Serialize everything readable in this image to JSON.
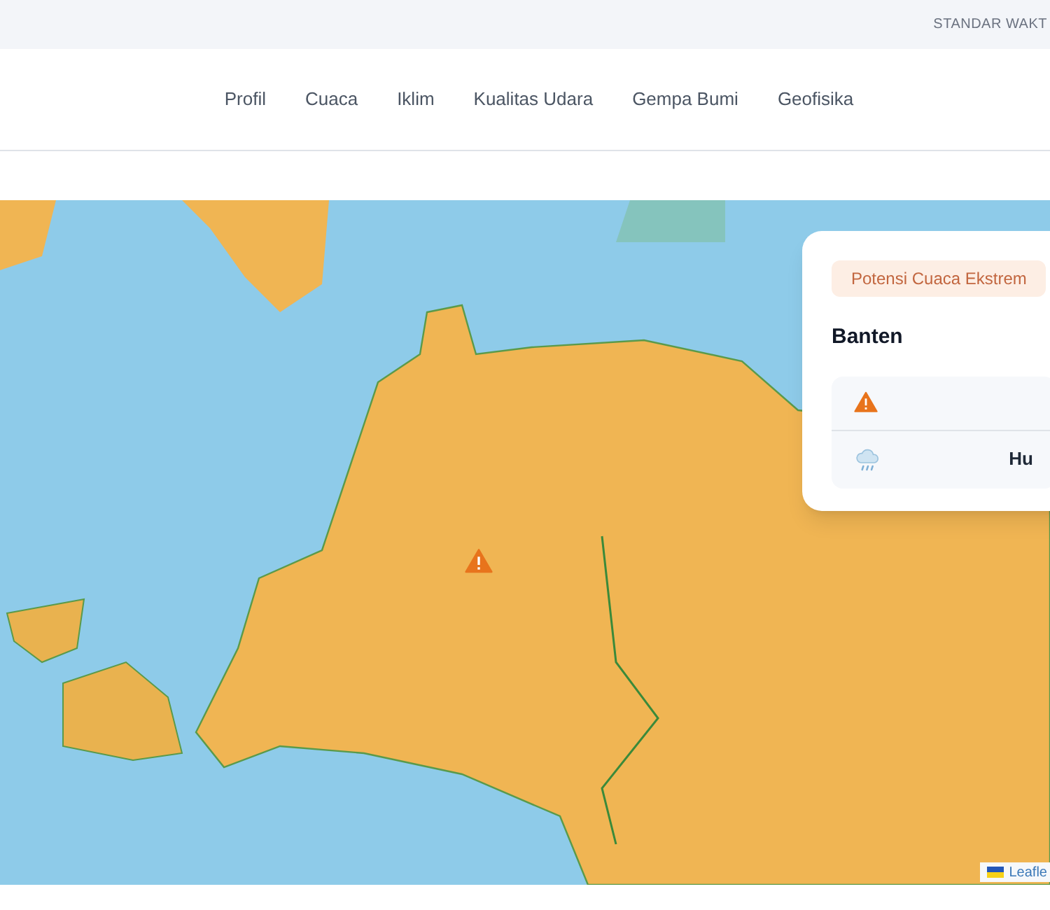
{
  "top_bar": {
    "text": "STANDAR WAKT"
  },
  "nav": {
    "items": [
      {
        "label": "Profil"
      },
      {
        "label": "Cuaca"
      },
      {
        "label": "Iklim"
      },
      {
        "label": "Kualitas Udara"
      },
      {
        "label": "Gempa Bumi"
      },
      {
        "label": "Geofisika"
      }
    ]
  },
  "map": {
    "alert_card": {
      "badge": "Potensi Cuaca Ekstrem",
      "title": "Banten",
      "rows": [
        {
          "kind": "warning"
        },
        {
          "kind": "rain",
          "text": "Hu"
        }
      ]
    },
    "attribution": {
      "text": "Leafle"
    }
  }
}
